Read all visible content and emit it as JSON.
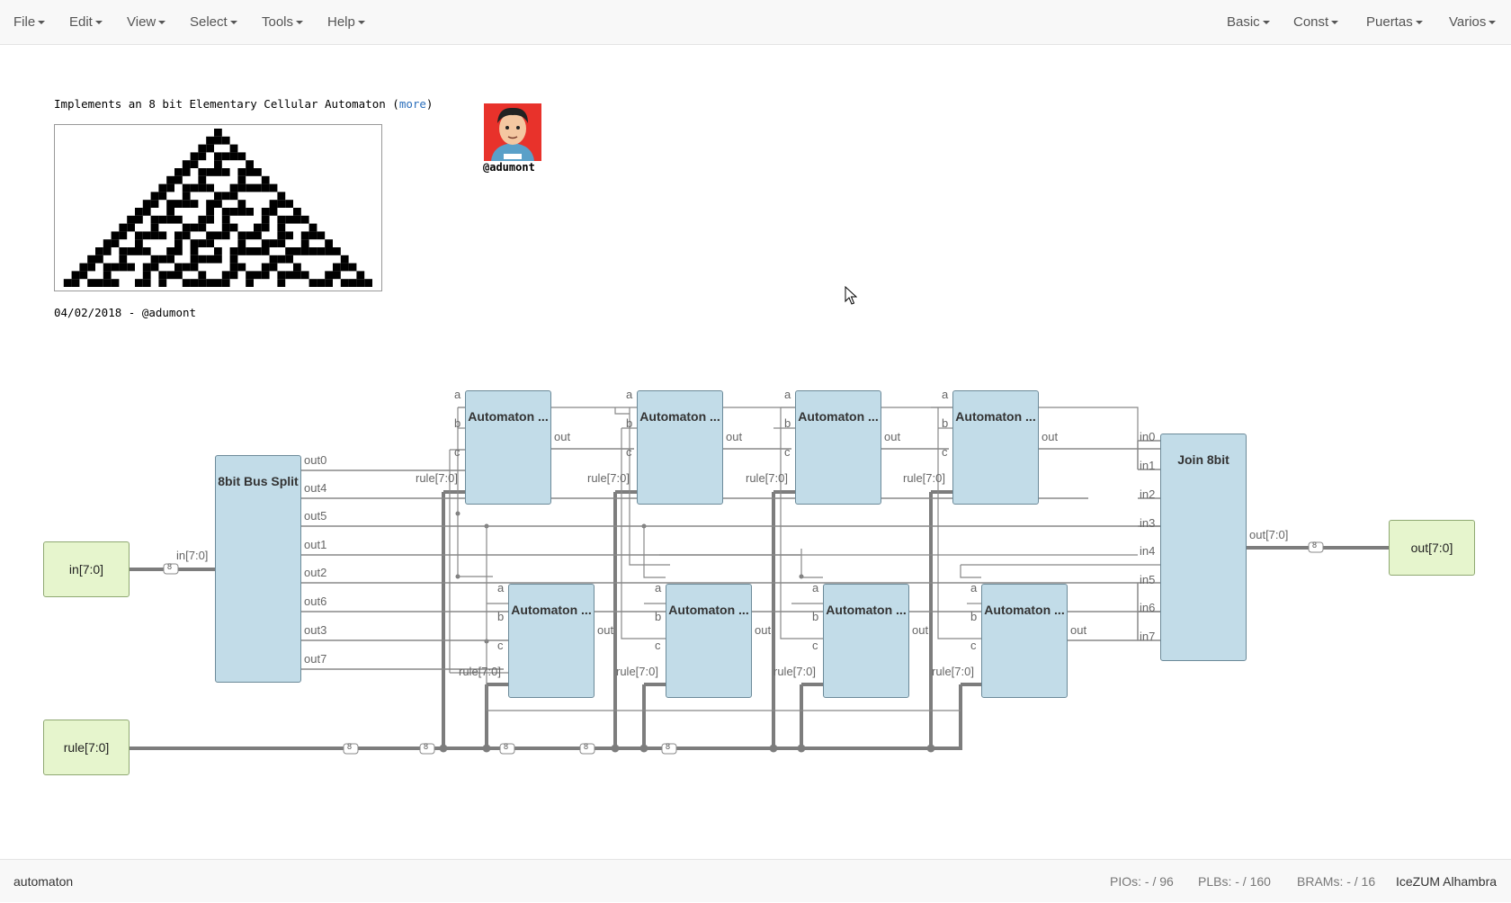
{
  "menubar": {
    "left": [
      "File",
      "Edit",
      "View",
      "Select",
      "Tools",
      "Help"
    ],
    "right": [
      "Basic",
      "Const",
      "Puertas",
      "Varios"
    ]
  },
  "canvas": {
    "description": "Implements an 8 bit Elementary Cellular Automaton (",
    "description_link": "more",
    "description_end": ")",
    "date_line": "04/02/2018 - @adumont",
    "avatar_label": "@adumont",
    "blocks": {
      "input_in": "in[7:0]",
      "input_rule": "rule[7:0]",
      "output_out": "out[7:0]",
      "bus_split": {
        "title": "8bit Bus Split",
        "in_port": "in[7:0]",
        "outputs": [
          "out0",
          "out4",
          "out5",
          "out1",
          "out2",
          "out6",
          "out3",
          "out7"
        ]
      },
      "automaton": {
        "title": "Automaton ...",
        "in_a": "a",
        "in_b": "b",
        "in_c": "c",
        "in_rule": "rule[7:0]",
        "out": "out"
      },
      "join": {
        "title": "Join 8bit",
        "inputs": [
          "in0",
          "in1",
          "in2",
          "in3",
          "in4",
          "in5",
          "in6",
          "in7"
        ],
        "out_port": "out[7:0]"
      }
    },
    "bus_width_label": "8"
  },
  "statusbar": {
    "project": "automaton",
    "pios": "PIOs: - / 96",
    "plbs": "PLBs: - / 160",
    "brams": "BRAMs: - / 16",
    "board": "IceZUM Alhambra"
  }
}
